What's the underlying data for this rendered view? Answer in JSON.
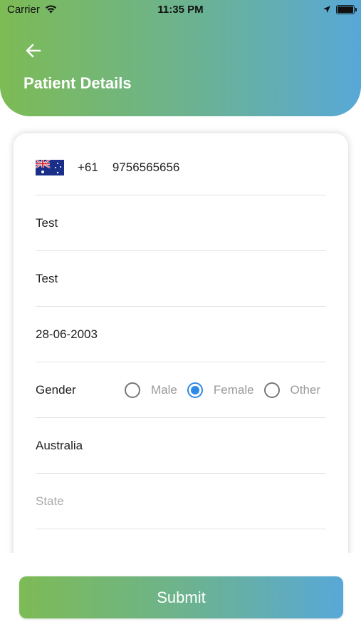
{
  "status_bar": {
    "carrier": "Carrier",
    "time": "11:35 PM"
  },
  "header": {
    "title": "Patient Details"
  },
  "form": {
    "phone": {
      "country": "Australia",
      "dial_code": "+61",
      "number": "9756565656"
    },
    "first_name": "Test",
    "last_name": "Test",
    "dob": "28-06-2003",
    "gender": {
      "label": "Gender",
      "options": [
        "Male",
        "Female",
        "Other"
      ],
      "selected": "Female"
    },
    "country": "Australia",
    "state_placeholder": "State"
  },
  "submit_label": "Submit",
  "colors": {
    "gradient_start": "#7dbb55",
    "gradient_end": "#58a8d8",
    "radio_selected": "#2e8ae6"
  }
}
